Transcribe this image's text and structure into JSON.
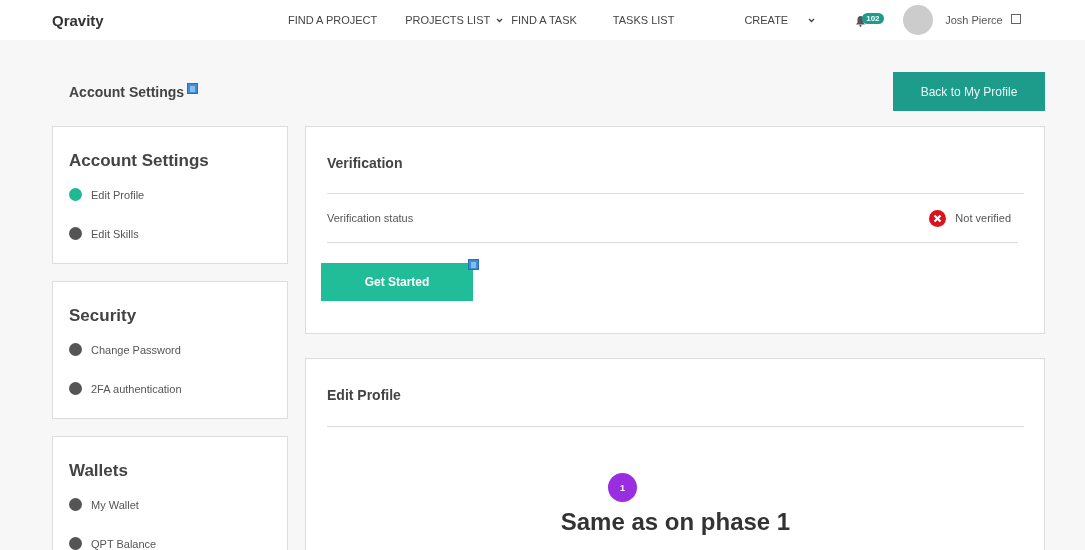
{
  "header": {
    "logo": "Qravity",
    "nav": [
      {
        "label": "FIND A PROJECT",
        "kind": "link"
      },
      {
        "label": "PROJECTS LIST",
        "kind": "dropdown"
      },
      {
        "label": "FIND A TASK",
        "kind": "link"
      },
      {
        "label": "TASKS LIST",
        "kind": "link"
      },
      {
        "label": "CREATE",
        "kind": "dropdown-wide"
      }
    ],
    "notification_count": "102",
    "user_name": "Josh Pierce"
  },
  "page_title": "Account Settings",
  "back_button": "Back to My Profile",
  "sidebar": [
    {
      "title": "Account Settings",
      "items": [
        {
          "label": "Edit Profile",
          "selected": true
        },
        {
          "label": "Edit Skills",
          "selected": false
        }
      ]
    },
    {
      "title": "Security",
      "items": [
        {
          "label": "Change Password",
          "selected": false
        },
        {
          "label": "2FA authentication",
          "selected": false
        }
      ]
    },
    {
      "title": "Wallets",
      "items": [
        {
          "label": "My Wallet",
          "selected": false
        },
        {
          "label": "QPT Balance",
          "selected": false
        }
      ]
    }
  ],
  "verification": {
    "title": "Verification",
    "status_label": "Verification status",
    "verified": false,
    "status_text": "Not verified",
    "button": "Get Started"
  },
  "edit_profile": {
    "title": "Edit Profile",
    "step": "1",
    "heading": "Same as on phase 1"
  }
}
